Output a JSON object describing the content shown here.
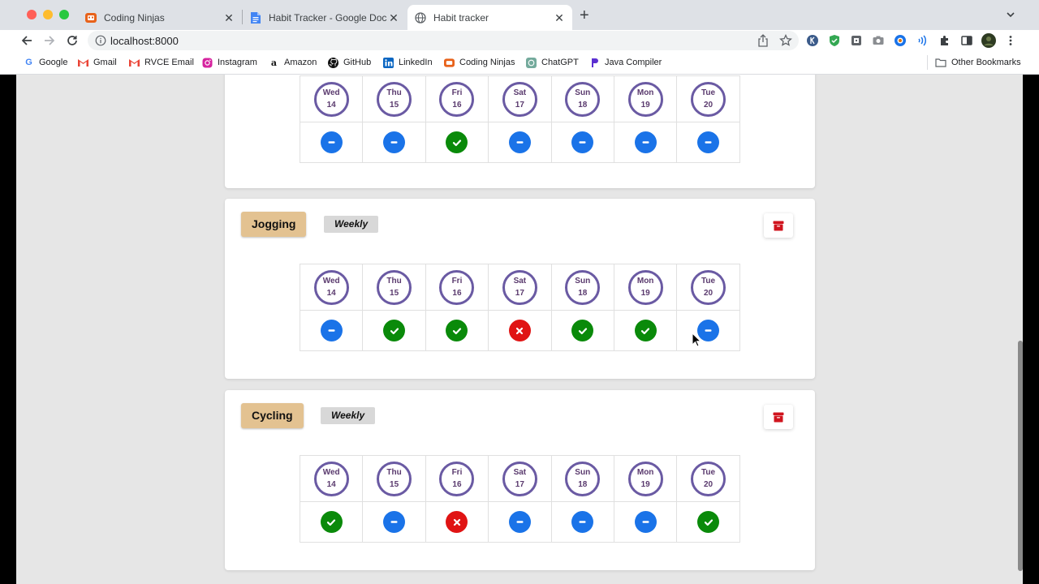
{
  "browser": {
    "tabs": [
      {
        "title": "Coding Ninjas",
        "icon": "coding-ninjas-icon",
        "active": false
      },
      {
        "title": "Habit Tracker - Google Docs",
        "icon": "google-docs-icon",
        "active": false
      },
      {
        "title": "Habit tracker",
        "icon": "globe-icon",
        "active": true
      }
    ],
    "url": "localhost:8000",
    "bookmarks": [
      {
        "label": "Google",
        "icon": "google-icon"
      },
      {
        "label": "Gmail",
        "icon": "gmail-icon"
      },
      {
        "label": "RVCE Email",
        "icon": "gmail-icon"
      },
      {
        "label": "Instagram",
        "icon": "instagram-icon"
      },
      {
        "label": "Amazon",
        "icon": "amazon-icon"
      },
      {
        "label": "GitHub",
        "icon": "github-icon"
      },
      {
        "label": "LinkedIn",
        "icon": "linkedin-icon"
      },
      {
        "label": "Coding Ninjas",
        "icon": "coding-ninjas-icon"
      },
      {
        "label": "ChatGPT",
        "icon": "chatgpt-icon"
      },
      {
        "label": "Java Compiler",
        "icon": "java-compiler-icon"
      }
    ],
    "other_bookmarks": "Other Bookmarks"
  },
  "colors": {
    "accent_purple": "#6a5aa3",
    "habit_tag": "#e3c291",
    "status_none": "#1a73e8",
    "status_done": "#0a8a0a",
    "status_notdone": "#e01414",
    "delete_red": "#d0141e"
  },
  "days": [
    {
      "day": "Wed",
      "date": "14"
    },
    {
      "day": "Thu",
      "date": "15"
    },
    {
      "day": "Fri",
      "date": "16"
    },
    {
      "day": "Sat",
      "date": "17"
    },
    {
      "day": "Sun",
      "date": "18"
    },
    {
      "day": "Mon",
      "date": "19"
    },
    {
      "day": "Tue",
      "date": "20"
    }
  ],
  "habits": [
    {
      "name": "",
      "frequency": "",
      "statuses": [
        "none",
        "none",
        "done",
        "none",
        "none",
        "none",
        "none"
      ]
    },
    {
      "name": "Jogging",
      "frequency": "Weekly",
      "statuses": [
        "none",
        "done",
        "done",
        "notdone",
        "done",
        "done",
        "none"
      ]
    },
    {
      "name": "Cycling",
      "frequency": "Weekly",
      "statuses": [
        "done",
        "none",
        "notdone",
        "none",
        "none",
        "none",
        "done"
      ]
    }
  ]
}
